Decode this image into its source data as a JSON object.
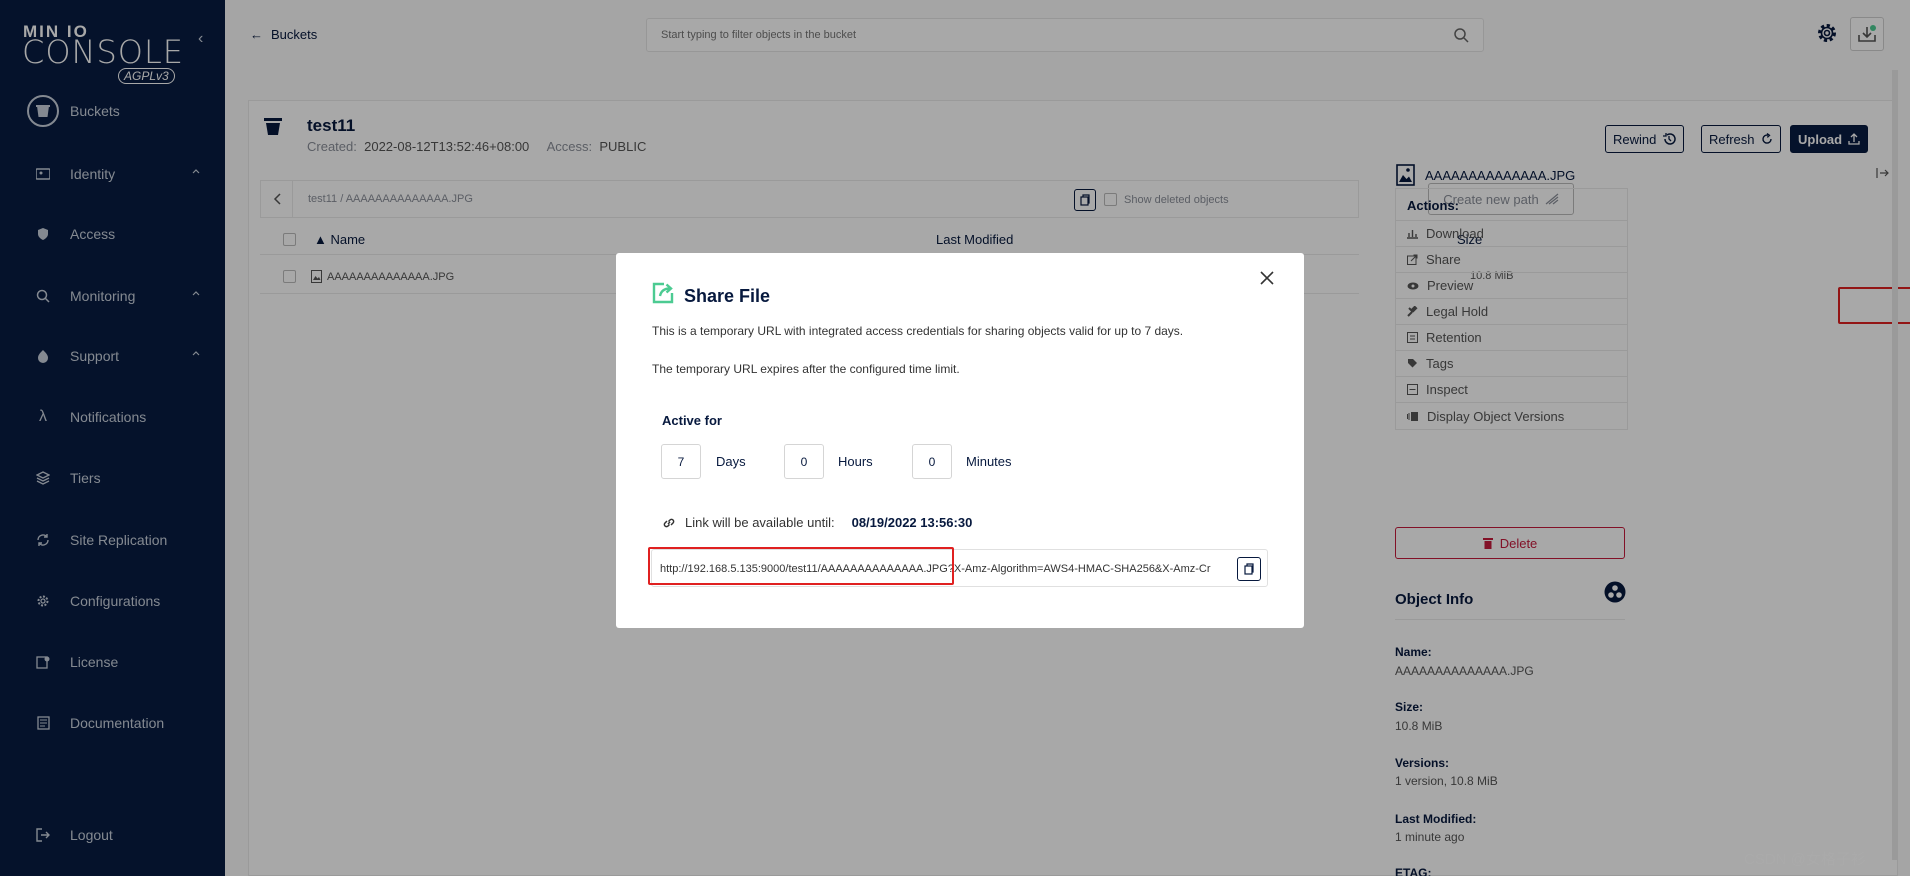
{
  "sidebar": {
    "logo_top": "MIN IO",
    "logo_main": "CONSOLE",
    "logo_badge": "AGPLv3",
    "items": [
      {
        "label": "Buckets",
        "icon": "bucket-icon"
      },
      {
        "label": "Identity",
        "icon": "identity-icon"
      },
      {
        "label": "Access",
        "icon": "lock-icon"
      },
      {
        "label": "Monitoring",
        "icon": "search-icon"
      },
      {
        "label": "Support",
        "icon": "support-icon"
      },
      {
        "label": "Notifications",
        "icon": "lambda-icon"
      },
      {
        "label": "Tiers",
        "icon": "tiers-icon"
      },
      {
        "label": "Site Replication",
        "icon": "replication-icon"
      },
      {
        "label": "Configurations",
        "icon": "gear-icon"
      },
      {
        "label": "License",
        "icon": "license-icon"
      },
      {
        "label": "Documentation",
        "icon": "document-icon"
      },
      {
        "label": "Logout",
        "icon": "logout-icon"
      }
    ]
  },
  "header": {
    "back_label": "Buckets",
    "filter_placeholder": "Start typing to filter objects in the bucket"
  },
  "bucket": {
    "name": "test11",
    "created_label": "Created:",
    "created_value": "2022-08-12T13:52:46+08:00",
    "access_label": "Access:",
    "access_value": "PUBLIC",
    "rewind_label": "Rewind",
    "refresh_label": "Refresh",
    "upload_label": "Upload"
  },
  "browser": {
    "path": "test11 / AAAAAAAAAAAAAA.JPG",
    "show_deleted_label": "Show deleted objects",
    "new_path_label": "Create new path",
    "columns": [
      "Name",
      "Last Modified",
      "Size"
    ],
    "rows": [
      {
        "name": "AAAAAAAAAAAAAA.JPG",
        "last_modified": "",
        "size": "10.8 MiB"
      }
    ]
  },
  "panel": {
    "file_name": "AAAAAAAAAAAAAA.JPG",
    "actions_title": "Actions:",
    "actions": [
      {
        "label": "Download",
        "icon": "download-icon"
      },
      {
        "label": "Share",
        "icon": "share-icon"
      },
      {
        "label": "Preview",
        "icon": "eye-icon"
      },
      {
        "label": "Legal Hold",
        "icon": "gavel-icon"
      },
      {
        "label": "Retention",
        "icon": "retention-icon"
      },
      {
        "label": "Tags",
        "icon": "tag-icon"
      },
      {
        "label": "Inspect",
        "icon": "inspect-icon"
      },
      {
        "label": "Display Object Versions",
        "icon": "versions-icon"
      }
    ],
    "delete_label": "Delete",
    "info_title": "Object Info",
    "info": [
      {
        "key": "Name:",
        "value": "AAAAAAAAAAAAAA.JPG"
      },
      {
        "key": "Size:",
        "value": "10.8 MiB"
      },
      {
        "key": "Versions:",
        "value": "1 version, 10.8 MiB"
      },
      {
        "key": "Last Modified:",
        "value": "1 minute ago"
      },
      {
        "key": "ETAG:",
        "value": ""
      }
    ]
  },
  "modal": {
    "title": "Share File",
    "desc1": "This is a temporary URL with integrated access credentials for sharing objects valid for up to 7 days.",
    "desc2": "The temporary URL expires after the configured time limit.",
    "active_for": "Active for",
    "days_value": "7",
    "days_label": "Days",
    "hours_value": "0",
    "hours_label": "Hours",
    "minutes_value": "0",
    "minutes_label": "Minutes",
    "link_label": "Link will be available until:",
    "link_date": "08/19/2022 13:56:30",
    "url": "http://192.168.5.135:9000/test11/AAAAAAAAAAAAAA.JPG?X-Amz-Algorithm=AWS4-HMAC-SHA256&X-Amz-Cr"
  },
  "watermark": "CSDN @女格子衫",
  "colors": {
    "sidebar_bg": "#081c42",
    "accent_dark": "#07193e",
    "share_icon": "#4ccb92",
    "delete_red": "#c51b3c",
    "highlight_red": "#e02020"
  }
}
